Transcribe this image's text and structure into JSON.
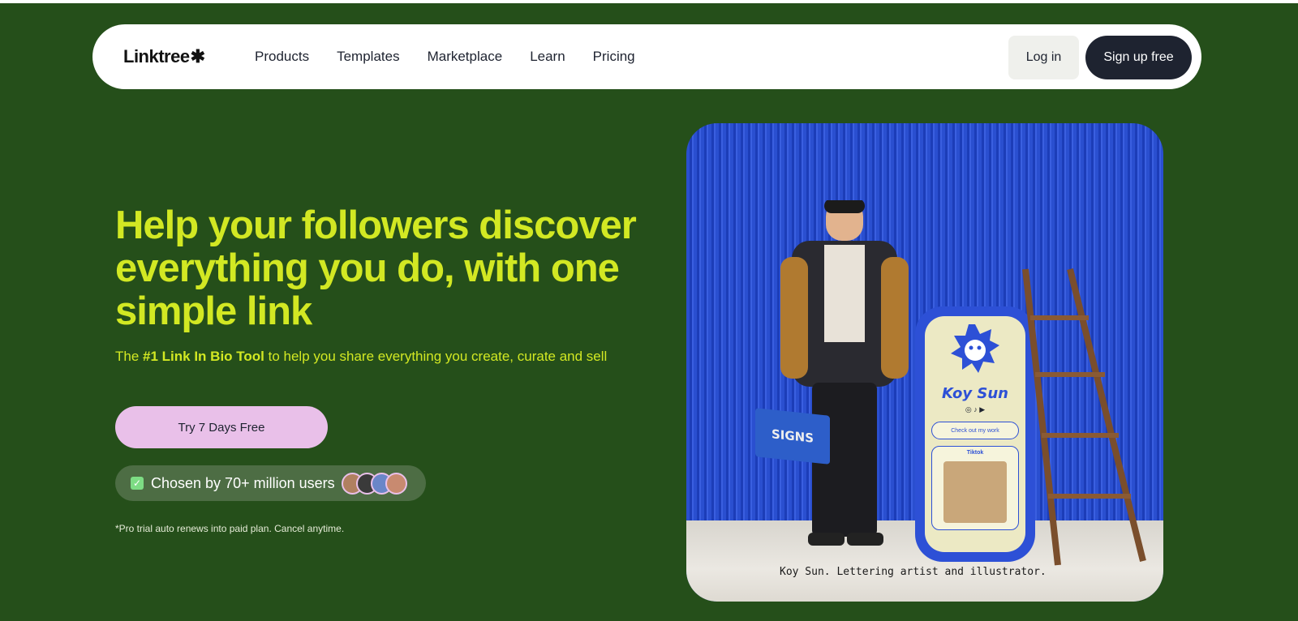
{
  "nav": {
    "logo_text": "Linktree",
    "logo_mark": "✱",
    "links": [
      "Products",
      "Templates",
      "Marketplace",
      "Learn",
      "Pricing"
    ],
    "login_label": "Log in",
    "signup_label": "Sign up free"
  },
  "hero": {
    "headline": "Help your followers discover everything you do, with one simple link",
    "sub_prefix": "The ",
    "sub_bold": "#1 Link In Bio Tool",
    "sub_suffix": " to help you share everything you create, curate and sell",
    "trial_label": "Try 7 Days Free",
    "chosen_text": "Chosen by 70+ million users",
    "footnote": "*Pro trial auto renews into paid plan. Cancel anytime.",
    "caption": "Koy Sun. Lettering artist and illustrator.",
    "phone_name": "Koy Sun",
    "phone_link": "Check out my work",
    "phone_card_title": "Tiktok",
    "toolbox_text": "SIGNS"
  },
  "colors": {
    "background": "#254f1a",
    "accent": "#d2e823",
    "trial_button": "#e9c0e9",
    "dark": "#1e2330"
  }
}
